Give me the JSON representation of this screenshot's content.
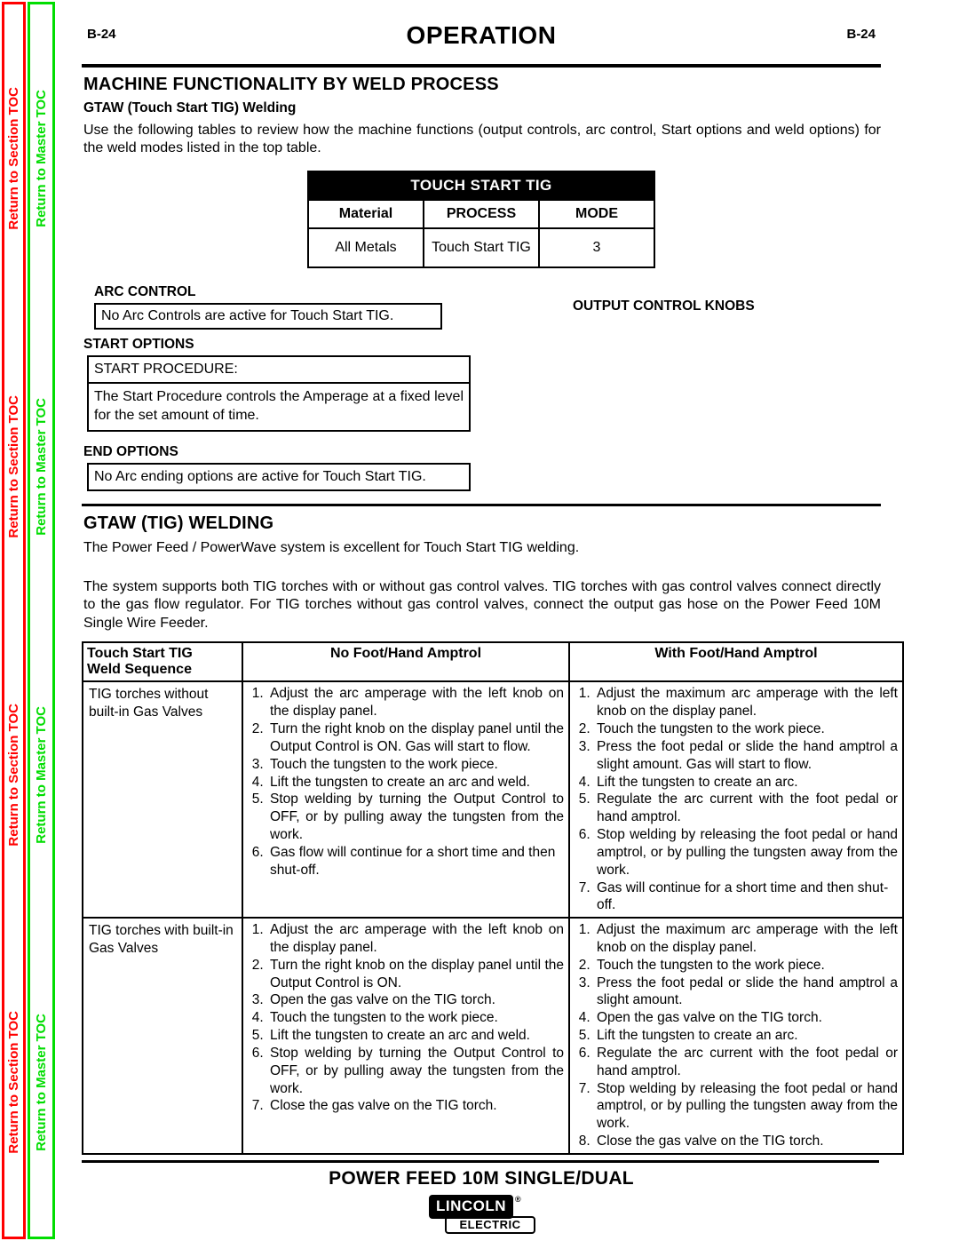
{
  "sidebar": {
    "section_toc_label": "Return to Section TOC",
    "master_toc_label": "Return to Master TOC",
    "section_color": "#ff0000",
    "master_color": "#00dd00",
    "repeat_count": 4
  },
  "header": {
    "page_number_left": "B-24",
    "title": "OPERATION",
    "page_number_right": "B-24"
  },
  "main": {
    "section_heading": "MACHINE FUNCTIONALITY BY WELD PROCESS",
    "subheading": "GTAW (Touch Start TIG) Welding",
    "intro_paragraph": "Use the following tables to review how the machine functions (output controls, arc control, Start options and weld options) for the weld modes listed in the top table."
  },
  "touch_start_tig_table": {
    "banner": "TOUCH START TIG",
    "columns": [
      "Material",
      "PROCESS",
      "MODE"
    ],
    "rows": [
      [
        "All Metals",
        "Touch Start TIG",
        "3"
      ]
    ]
  },
  "arc_control": {
    "label": "ARC CONTROL",
    "text": "No Arc Controls are active for Touch Start TIG."
  },
  "output_control_knobs": {
    "label": "OUTPUT CONTROL KNOBS"
  },
  "start_options": {
    "label": "START OPTIONS",
    "procedure_title": "START PROCEDURE:",
    "procedure_text": "The Start Procedure controls the Amperage at a fixed level for the set amount of time."
  },
  "end_options": {
    "label": "END  OPTIONS",
    "text": "No Arc ending options are active for Touch Start TIG."
  },
  "gtaw_section": {
    "heading": "GTAW (TIG) WELDING",
    "paragraph1": "The Power Feed / PowerWave system is excellent for Touch Start TIG welding.",
    "paragraph2": "The system supports both TIG torches with or without gas control valves.  TIG torches with gas control valves connect directly to the gas flow regulator.  For TIG torches without gas control valves, connect the output gas hose on the Power Feed 10M Single Wire Feeder."
  },
  "weld_sequence_table": {
    "col1_header_line1": "Touch   Start   TIG",
    "col1_header_line2": "Weld Sequence",
    "col2_header": "No Foot/Hand Amptrol",
    "col3_header": "With Foot/Hand Amptrol",
    "rows": [
      {
        "label": "TIG torches without built-in Gas Valves",
        "no_amptrol": [
          "Adjust the arc amperage with the left knob on the display panel.",
          "Turn the right knob on the display panel until the Output Control is ON.  Gas will start to flow.",
          "Touch the tungsten to the work piece.",
          "Lift the tungsten to create an arc and weld.",
          "Stop welding by turning the Output Control to OFF, or by pulling away the tungsten from the work.",
          "Gas flow will continue for a short time and then shut-off."
        ],
        "with_amptrol": [
          "Adjust the maximum arc amperage with the left knob on the display panel.",
          "Touch the tungsten to the work piece.",
          "Press the foot pedal or slide the hand amptrol a slight amount. Gas will start to flow.",
          "Lift the tungsten to create an arc.",
          "Regulate the arc current with the foot pedal or hand amptrol.",
          "Stop welding by releasing the foot pedal or hand amptrol, or by pulling the tungsten away from the work.",
          "Gas will continue for a short time and then shut-off."
        ]
      },
      {
        "label": "TIG torches with built-in Gas Valves",
        "no_amptrol": [
          "Adjust the arc amperage with the left knob on the display panel.",
          "Turn the right knob on the display panel until the Output Control is ON.",
          "Open the gas valve on the TIG torch.",
          "Touch the tungsten to the work piece.",
          "Lift the tungsten to create an arc and weld.",
          "Stop welding by turning the Output Control to OFF, or by pulling away the tungsten from the work.",
          "Close the gas valve on the TIG torch."
        ],
        "with_amptrol": [
          "Adjust the maximum arc amperage with the left knob on the display panel.",
          "Touch the tungsten to the work piece.",
          "Press the foot pedal or slide the hand amptrol a slight amount.",
          "Open the gas valve on the TIG torch.",
          "Lift the tungsten to create an arc.",
          "Regulate the arc current with the foot pedal or hand amptrol.",
          "Stop welding by releasing the foot pedal or hand amptrol, or by pulling the tungsten away from the work.",
          "Close the gas valve on the TIG torch."
        ]
      }
    ]
  },
  "footer": {
    "title": "POWER FEED 10M SINGLE/DUAL",
    "logo_line1": "LINCOLN",
    "logo_reg": "®",
    "logo_line2": "ELECTRIC"
  }
}
